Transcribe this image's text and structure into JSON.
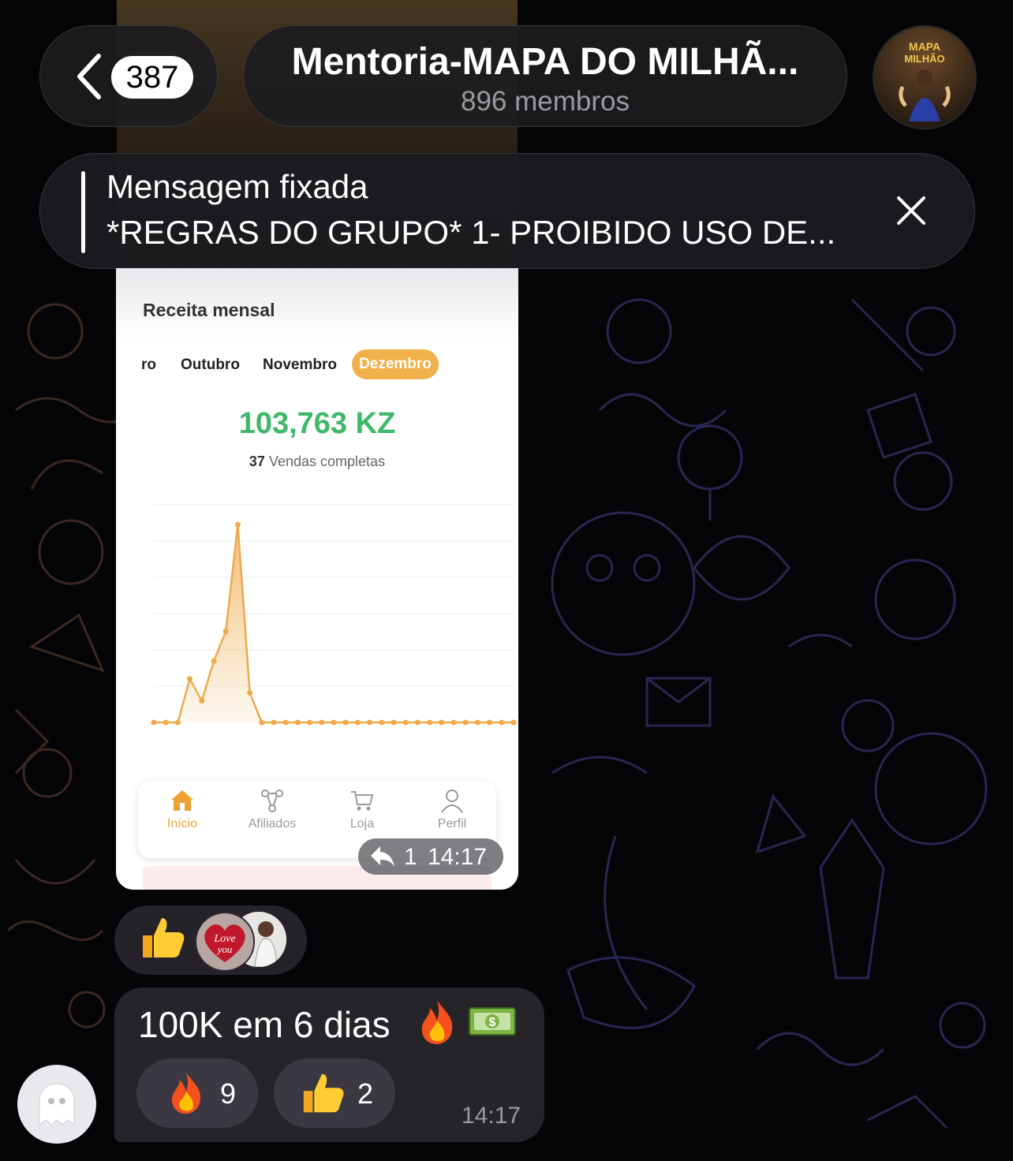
{
  "header": {
    "unread_count": "387",
    "chat_title": "Mentoria-MAPA DO MILHÃ...",
    "member_count": "896 membros",
    "avatar_text_top": "MAPA",
    "avatar_text_bottom": "MILHÃO"
  },
  "pinned": {
    "label": "Mensagem fixada",
    "text": "*REGRAS DO GRUPO* 1- PROIBIDO USO DE..."
  },
  "image_message": {
    "screenshot": {
      "section_title": "Receita mensal",
      "months": [
        "ro",
        "Outubro",
        "Novembro"
      ],
      "active_month": "Dezembro",
      "revenue": "103,763 KZ",
      "sales_count": "37",
      "sales_label": "Vendas completas",
      "nav": [
        {
          "label": "Início",
          "icon": "home-icon"
        },
        {
          "label": "Afiliados",
          "icon": "network-icon"
        },
        {
          "label": "Loja",
          "icon": "cart-icon"
        },
        {
          "label": "Perfil",
          "icon": "user-icon"
        }
      ],
      "chart_data": {
        "type": "area",
        "x": [
          1,
          2,
          3,
          4,
          5,
          6,
          7,
          8,
          9,
          10,
          11,
          12,
          13,
          14,
          15,
          16,
          17,
          18,
          19,
          20,
          21,
          22,
          23,
          24,
          25,
          26,
          27,
          28,
          29,
          30,
          31
        ],
        "values": [
          0,
          0,
          0,
          22,
          11,
          31,
          46,
          100,
          15,
          0,
          0,
          0,
          0,
          0,
          0,
          0,
          0,
          0,
          0,
          0,
          0,
          0,
          0,
          0,
          0,
          0,
          0,
          0,
          0,
          0,
          0
        ],
        "ylim": [
          0,
          110
        ],
        "grid": true,
        "color": "#f0a94a"
      }
    },
    "reply_count": "1",
    "time": "14:17",
    "reactions": [
      "thumbs-up-emoji",
      "love-you-avatar",
      "user-avatar"
    ]
  },
  "text_message": {
    "text": "100K em 6 dias",
    "emojis": [
      "fire-emoji",
      "money-emoji"
    ],
    "reactions": [
      {
        "emoji": "fire-emoji",
        "count": "9"
      },
      {
        "emoji": "thumbs-up-emoji",
        "count": "2"
      }
    ],
    "time": "14:17"
  },
  "colors": {
    "background": "#050507",
    "accent_orange": "#f2b04a",
    "revenue_green": "#3fb86a"
  }
}
